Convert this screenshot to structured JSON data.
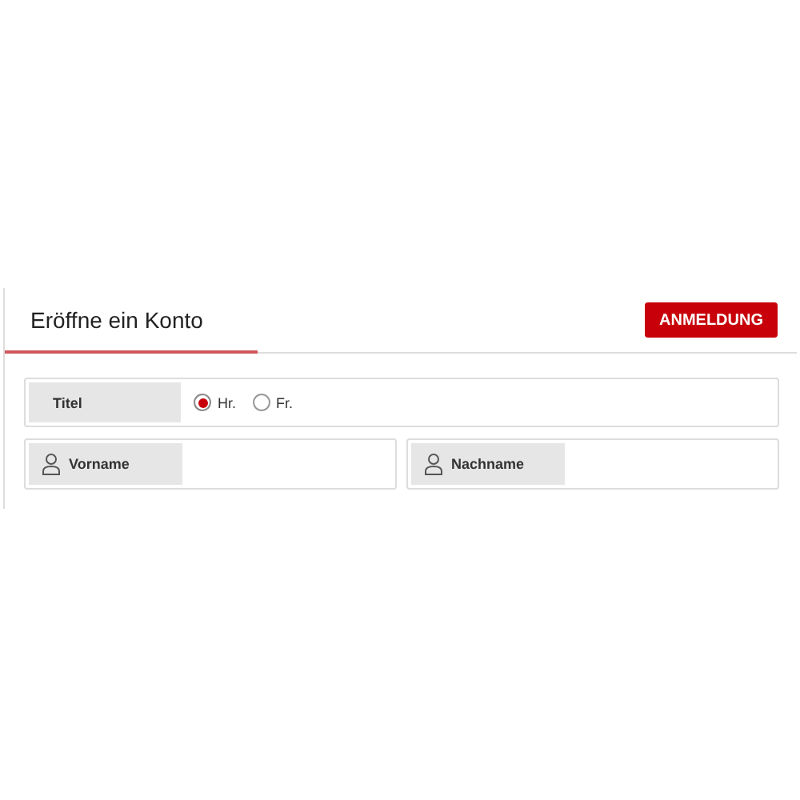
{
  "header": {
    "title": "Eröffne ein Konto",
    "login_button": "ANMELDUNG"
  },
  "title_field": {
    "label": "Titel",
    "options": [
      {
        "label": "Hr.",
        "selected": true
      },
      {
        "label": "Fr.",
        "selected": false
      }
    ]
  },
  "name_fields": [
    {
      "label": "Vorname"
    },
    {
      "label": "Nachname"
    }
  ]
}
